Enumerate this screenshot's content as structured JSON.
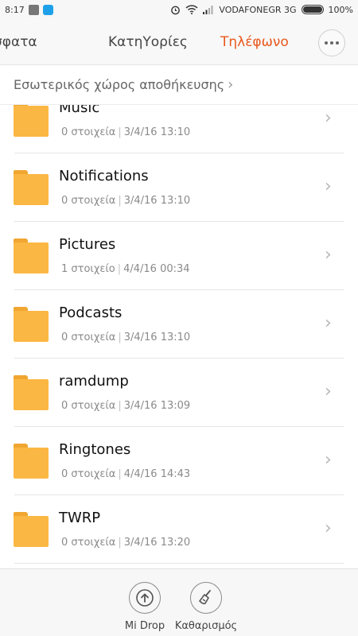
{
  "status_bar": {
    "time": "8:17",
    "carrier": "VODAFONEGR 3G",
    "battery": "100%"
  },
  "tabs": [
    {
      "label": "Πρόσφατα",
      "visible_text": "σφατα"
    },
    {
      "label": "ΚατηΥορίες"
    },
    {
      "label": "Τηλέφωνο",
      "active": true
    }
  ],
  "breadcrumb": {
    "label": "Εσωτερικός χώρος αποθήκευσης"
  },
  "files": [
    {
      "name": "Music",
      "count": "0 στοιχεία",
      "date": "3/4/16 13:10"
    },
    {
      "name": "Notifications",
      "count": "0 στοιχεία",
      "date": "3/4/16 13:10"
    },
    {
      "name": "Pictures",
      "count": "1 στοιχείο",
      "date": "4/4/16 00:34"
    },
    {
      "name": "Podcasts",
      "count": "0 στοιχεία",
      "date": "3/4/16 13:10"
    },
    {
      "name": "ramdump",
      "count": "0 στοιχεία",
      "date": "3/4/16 13:09"
    },
    {
      "name": "Ringtones",
      "count": "0 στοιχεία",
      "date": "4/4/16 14:43"
    },
    {
      "name": "TWRP",
      "count": "0 στοιχεία",
      "date": "3/4/16 13:20"
    }
  ],
  "bottom_actions": [
    {
      "label": "Mi Drop",
      "icon": "upload-icon"
    },
    {
      "label": "Καθαρισμός",
      "icon": "broom-icon"
    }
  ],
  "colors": {
    "accent": "#e8571b",
    "folder": "#fbb743"
  }
}
